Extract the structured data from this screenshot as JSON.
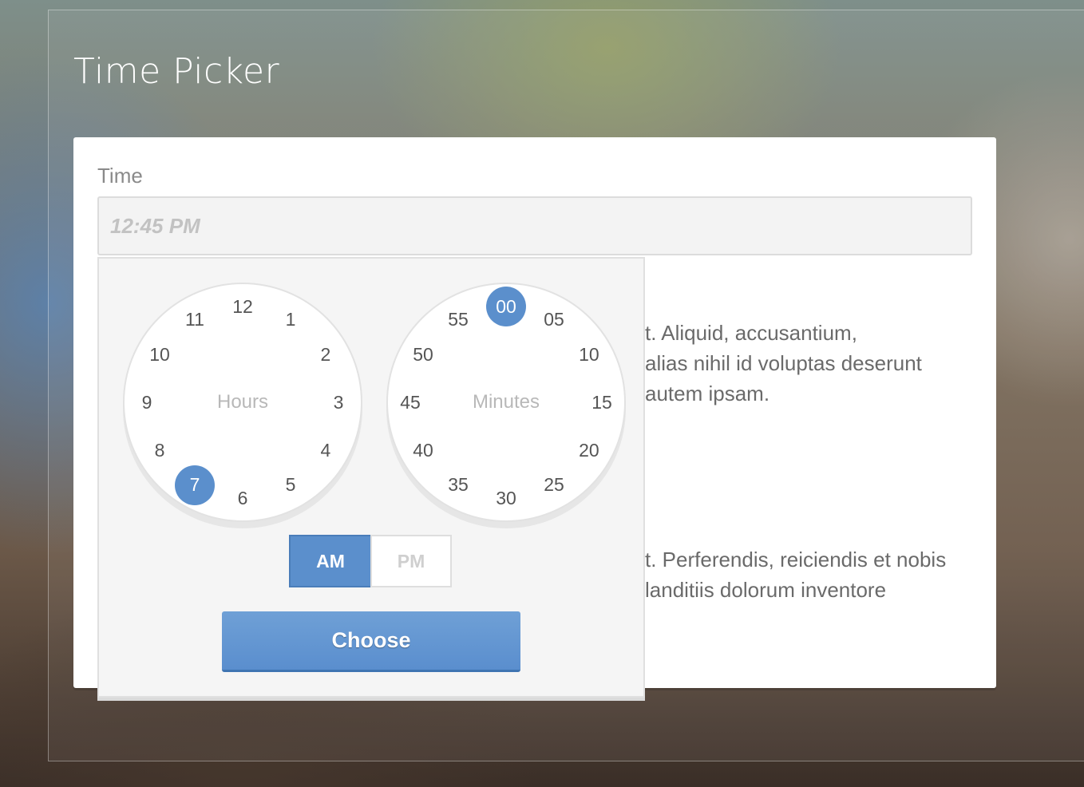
{
  "header": {
    "title": "Time Picker"
  },
  "form": {
    "time_label": "Time",
    "time_placeholder": "12:45 PM"
  },
  "content": {
    "paragraph_1": [
      "t. Aliquid, accusantium,",
      "alias nihil id voluptas deserunt",
      " autem ipsam."
    ],
    "paragraph_2": [
      "t. Perferendis, reiciendis et nobis",
      "landitiis dolorum inventore"
    ]
  },
  "picker": {
    "hours": {
      "label": "Hours",
      "ticks": [
        "12",
        "1",
        "2",
        "3",
        "4",
        "5",
        "6",
        "7",
        "8",
        "9",
        "10",
        "11"
      ],
      "selected": "7"
    },
    "minutes": {
      "label": "Minutes",
      "ticks": [
        "00",
        "05",
        "10",
        "15",
        "20",
        "25",
        "30",
        "35",
        "40",
        "45",
        "50",
        "55"
      ],
      "selected": "00"
    },
    "period": {
      "am": "AM",
      "pm": "PM",
      "selected": "AM"
    },
    "choose_label": "Choose"
  },
  "colors": {
    "accent": "#5b8fcc",
    "card": "#ffffff",
    "popup": "#f5f5f5"
  }
}
